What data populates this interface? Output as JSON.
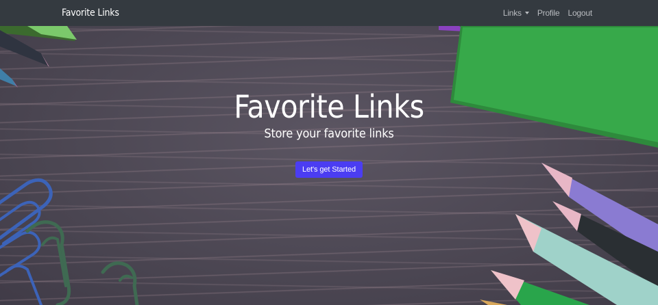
{
  "navbar": {
    "brand": "Favorite Links",
    "links_label": "Links",
    "profile_label": "Profile",
    "logout_label": "Logout"
  },
  "hero": {
    "title": "Favorite Links",
    "subtitle": "Store your favorite links",
    "cta_label": "Let's get Started"
  },
  "colors": {
    "navbar_bg": "#343a40",
    "cta_bg": "#4b3df2",
    "notebook_green": "#37a94a"
  },
  "icons": {
    "links_dropdown": "chevron-down-icon"
  }
}
